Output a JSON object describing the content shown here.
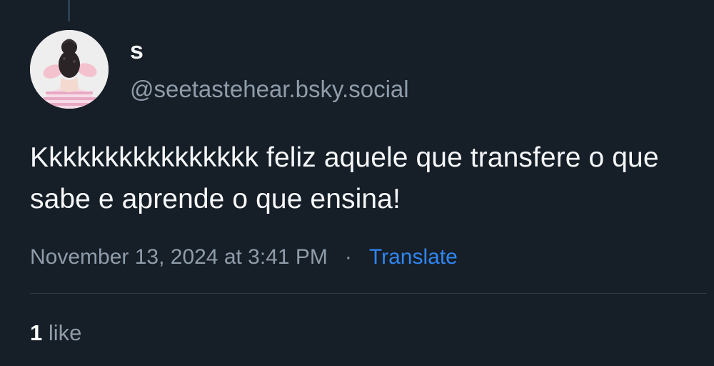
{
  "post": {
    "author": {
      "display_name": "s",
      "handle": "@seetastehear.bsky.social",
      "avatar_icon": "user-avatar-image"
    },
    "text": "Kkkkkkkkkkkkkkkk feliz aquele que transfere o que sabe e aprende o que ensina!",
    "timestamp": "November 13, 2024 at 3:41 PM",
    "separator": "·",
    "translate_label": "Translate",
    "likes": {
      "count": "1",
      "label": "like"
    }
  },
  "colors": {
    "background": "#161e27",
    "text_primary": "#f5f7f9",
    "text_secondary": "#8f9caa",
    "link": "#2f86f0",
    "divider": "#2c3947"
  }
}
